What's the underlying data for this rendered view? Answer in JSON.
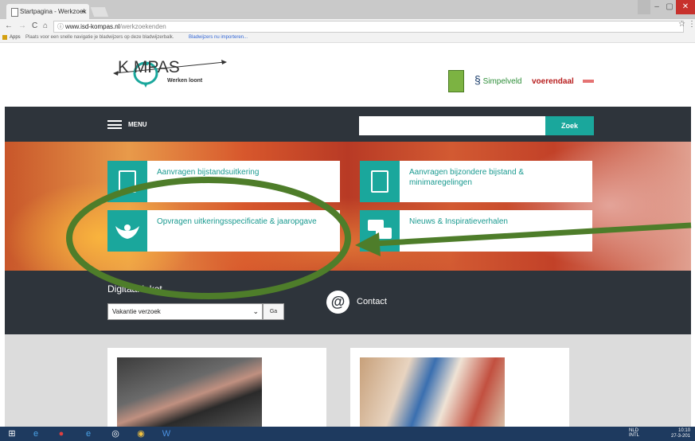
{
  "browser": {
    "tab_title": "Startpagina - Werkzoek",
    "tab_close": "×",
    "url_prefix": "www.isd-kompas.nl",
    "url_path": "/werkzoekenden",
    "nav_back": "←",
    "nav_forward": "→",
    "nav_reload": "C",
    "nav_home": "⌂",
    "info_icon": "ⓘ",
    "star": "☆",
    "more": "⋮",
    "win_minimize": "–",
    "win_maximize": "▢",
    "win_close": "✕",
    "bookmarks_apps": "Apps",
    "bookmarks_msg": "Plaats voor een snelle navigatie je bladwijzers op deze bladwijzerbalk.",
    "bookmarks_import": "Bladwijzers nu importeren..."
  },
  "header": {
    "logo_text": "K   MPAS",
    "logo_tagline": "Werken loont",
    "partner_simpelveld": "Simpelveld",
    "partner_voerendaal": "voerendaal"
  },
  "nav": {
    "menu_label": "MENU",
    "search_placeholder": "",
    "search_button": "Zoek"
  },
  "cards": [
    {
      "label": "Aanvragen bijstandsuitkering"
    },
    {
      "label": "Aanvragen bijzondere bijstand & minimaregelingen"
    },
    {
      "label": "Opvragen uitkeringsspecificatie & jaaropgave"
    },
    {
      "label": "Nieuws & Inspiratieverhalen"
    }
  ],
  "loket": {
    "title": "Digitaal loket",
    "select_value": "Vakantie verzoek",
    "go_button": "Ga",
    "contact_icon": "@",
    "contact_label": "Contact"
  },
  "taskbar": {
    "tray_lang": "NLD",
    "tray_sub": "INTL",
    "clock_time": "10:10",
    "clock_date": "27-3-201"
  },
  "colors": {
    "accent": "#1aa79c",
    "dark_band": "#2e343b",
    "annotation": "#4e7d2a"
  }
}
